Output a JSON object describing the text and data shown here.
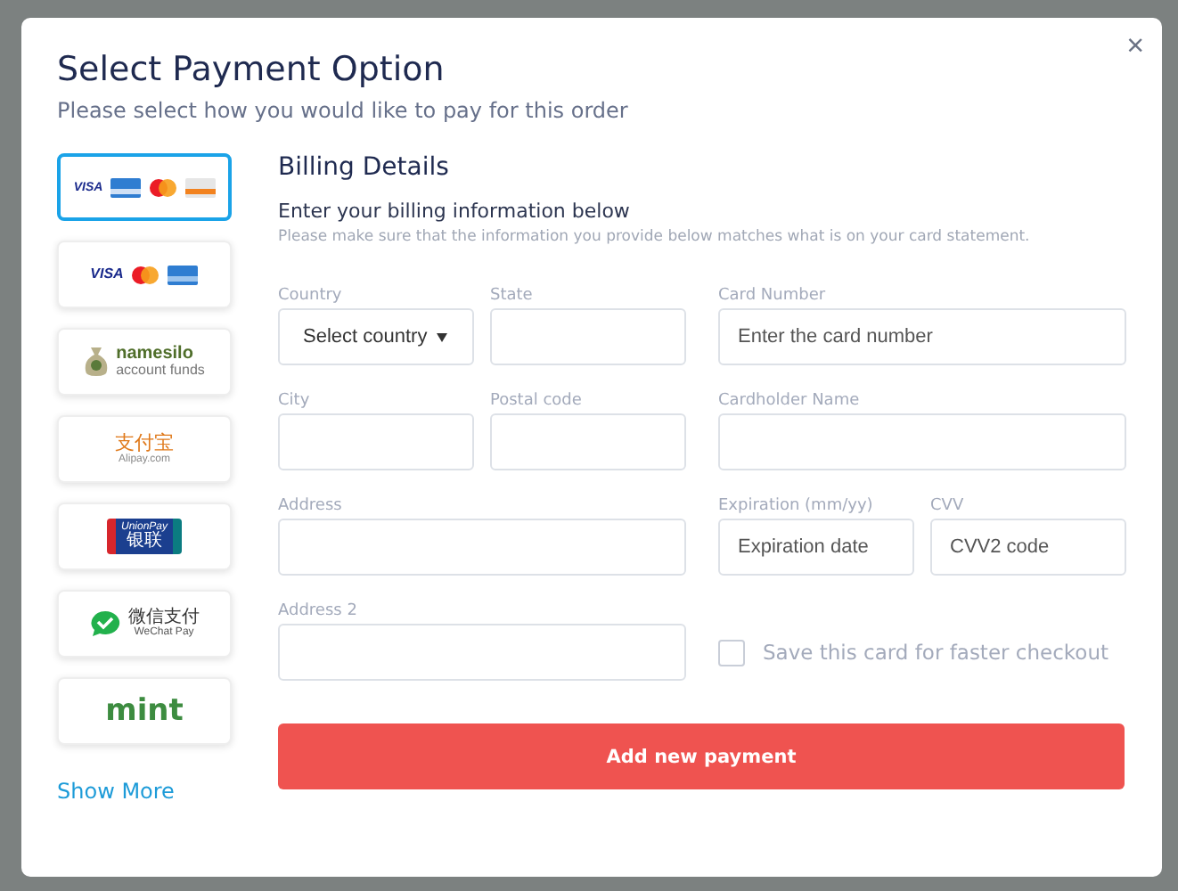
{
  "dialog": {
    "title": "Select Payment Option",
    "subtitle": "Please select how you would like to pay for this order",
    "close": "×"
  },
  "payment_options": [
    {
      "kind": "cards-four",
      "selected": true,
      "texts": [
        "VISA"
      ]
    },
    {
      "kind": "cards-three",
      "selected": false,
      "texts": [
        "VISA"
      ]
    },
    {
      "kind": "namesilo",
      "selected": false,
      "texts": [
        "namesilo",
        "account funds"
      ]
    },
    {
      "kind": "alipay",
      "selected": false,
      "texts": [
        "支付宝",
        "Alipay.com"
      ]
    },
    {
      "kind": "unionpay",
      "selected": false,
      "texts": [
        "UnionPay",
        "银联"
      ]
    },
    {
      "kind": "wechat",
      "selected": false,
      "texts": [
        "微信支付",
        "WeChat Pay"
      ]
    },
    {
      "kind": "mint",
      "selected": false,
      "texts": [
        "mint"
      ]
    }
  ],
  "show_more": "Show More",
  "billing": {
    "title": "Billing Details",
    "intro": "Enter your billing information below",
    "note": "Please make sure that the information you provide below matches what is on your card statement.",
    "left_rows": [
      [
        {
          "kind": "select",
          "label": "Country",
          "value": "Select country"
        },
        {
          "kind": "text",
          "label": "State"
        }
      ],
      [
        {
          "kind": "text",
          "label": "City"
        },
        {
          "kind": "text",
          "label": "Postal code"
        }
      ],
      [
        {
          "kind": "text",
          "label": "Address"
        }
      ],
      [
        {
          "kind": "text",
          "label": "Address 2"
        }
      ]
    ],
    "right_rows": [
      [
        {
          "kind": "text",
          "label": "Card Number",
          "placeholder": "Enter the card number"
        }
      ],
      [
        {
          "kind": "text",
          "label": "Cardholder Name"
        }
      ],
      [
        {
          "kind": "text",
          "label": "Expiration (mm/yy)",
          "placeholder": "Expiration date"
        },
        {
          "kind": "text",
          "label": "CVV",
          "placeholder": "CVV2 code"
        }
      ],
      [
        {
          "kind": "checkbox",
          "label": "Save this card for faster checkout",
          "checked": false
        }
      ]
    ]
  },
  "submit": "Add new payment"
}
